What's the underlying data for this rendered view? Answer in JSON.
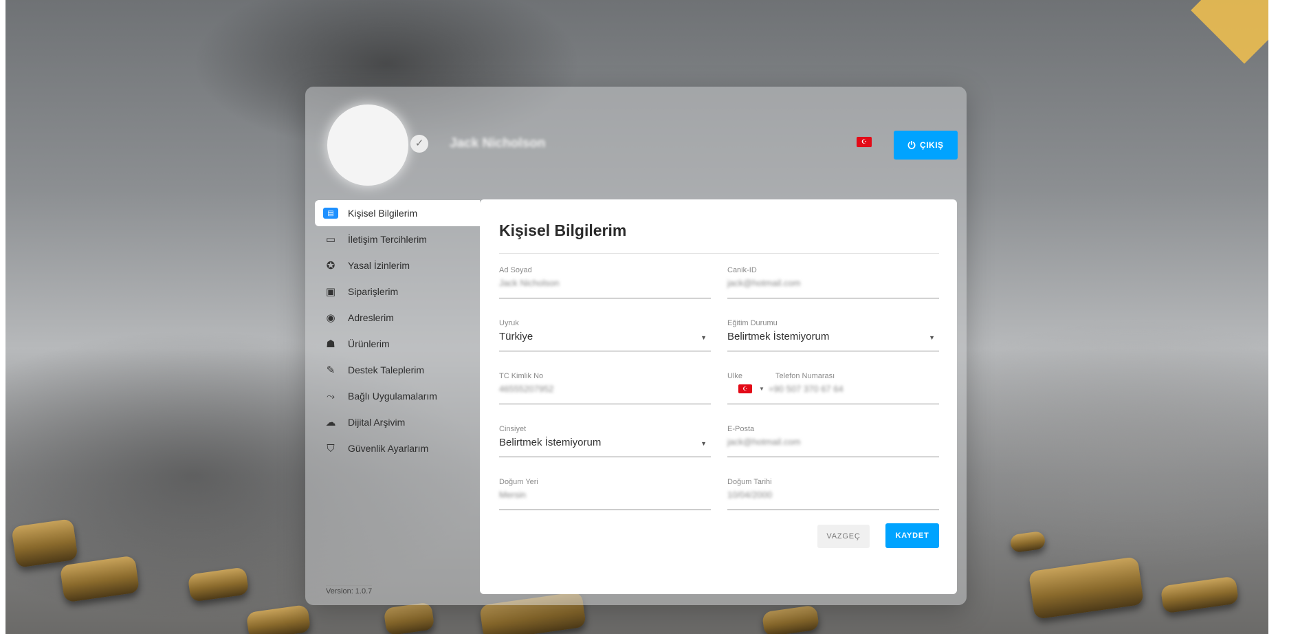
{
  "header": {
    "user_name": "Jack Nicholson",
    "language_flag": "TR",
    "logout_label": "ÇIKIŞ"
  },
  "sidebar": {
    "items": [
      {
        "label": "Kişisel Bilgilerim",
        "icon": "id-card-icon",
        "active": true
      },
      {
        "label": "İletişim Tercihlerim",
        "icon": "chat-icon"
      },
      {
        "label": "Yasal İzinlerim",
        "icon": "badge-check-icon"
      },
      {
        "label": "Siparişlerim",
        "icon": "box-icon"
      },
      {
        "label": "Adreslerim",
        "icon": "location-pin-icon"
      },
      {
        "label": "Ürünlerim",
        "icon": "products-icon"
      },
      {
        "label": "Destek Taleplerim",
        "icon": "support-edit-icon"
      },
      {
        "label": "Bağlı Uygulamalarım",
        "icon": "connected-apps-icon"
      },
      {
        "label": "Dijital Arşivim",
        "icon": "cloud-archive-icon"
      },
      {
        "label": "Güvenlik Ayarlarım",
        "icon": "shield-icon"
      }
    ],
    "version": "Version: 1.0.7"
  },
  "form": {
    "title": "Kişisel Bilgilerim",
    "full_name": {
      "label": "Ad Soyad",
      "value": "Jack Nicholson"
    },
    "canik_id": {
      "label": "Canik-ID",
      "value": "jack@hotmail.com"
    },
    "nationality": {
      "label": "Uyruk",
      "value": "Türkiye"
    },
    "education": {
      "label": "Eğitim Durumu",
      "value": "Belirtmek İstemiyorum"
    },
    "tc_no": {
      "label": "TC Kimlik No",
      "value": "46555207952"
    },
    "phone": {
      "country_label": "Ulke",
      "label": "Telefon Numarası",
      "flag": "TR",
      "value": "+90 507 370 67 64"
    },
    "gender": {
      "label": "Cinsiyet",
      "value": "Belirtmek İstemiyorum"
    },
    "email": {
      "label": "E-Posta",
      "value": "jack@hotmail.com"
    },
    "birth_place": {
      "label": "Doğum Yeri",
      "value": "Mersin"
    },
    "birth_date": {
      "label": "Doğum Tarihi",
      "value": "10/04/2000"
    },
    "cancel_label": "VAZGEÇ",
    "save_label": "KAYDET"
  },
  "colors": {
    "accent": "#00a3ff",
    "flag_red": "#e30a17"
  }
}
